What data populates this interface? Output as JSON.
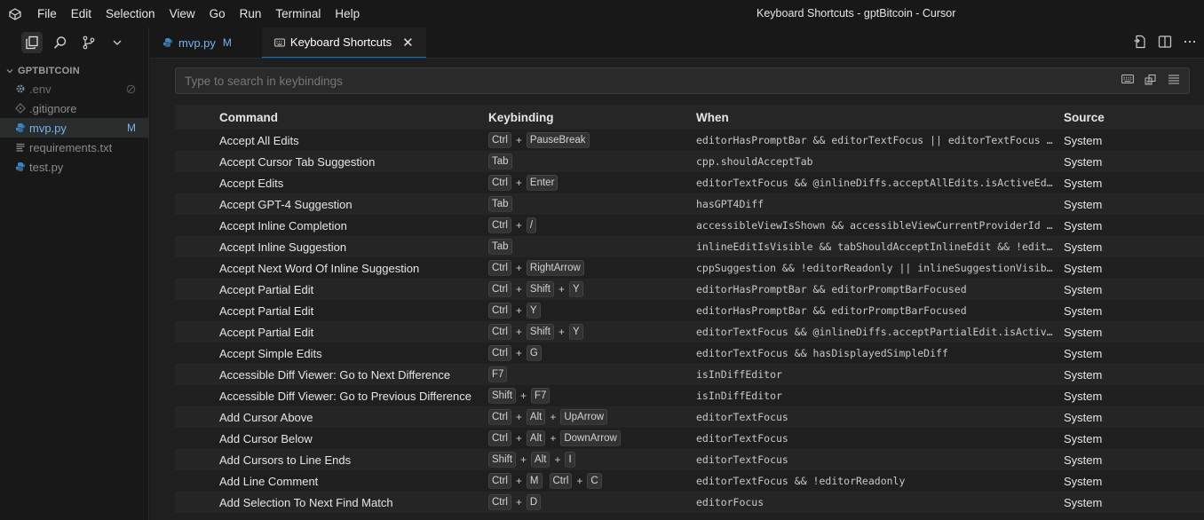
{
  "menu": [
    "File",
    "Edit",
    "Selection",
    "View",
    "Go",
    "Run",
    "Terminal",
    "Help"
  ],
  "window_title": "Keyboard Shortcuts - gptBitcoin - Cursor",
  "explorer": {
    "title": "GPTBITCOIN",
    "files": [
      {
        "name": ".env",
        "icon": "gear-icon",
        "state": "ignored"
      },
      {
        "name": ".gitignore",
        "icon": "git-icon",
        "state": "muted"
      },
      {
        "name": "mvp.py",
        "icon": "python-icon",
        "state": "selected",
        "badge": "M"
      },
      {
        "name": "requirements.txt",
        "icon": "lines-icon",
        "state": "muted"
      },
      {
        "name": "test.py",
        "icon": "python-icon",
        "state": "muted"
      }
    ]
  },
  "tabs": [
    {
      "label": "mvp.py",
      "badge": "M",
      "active": false
    },
    {
      "label": "Keyboard Shortcuts",
      "active": true
    }
  ],
  "search": {
    "placeholder": "Type to search in keybindings"
  },
  "columns": {
    "command": "Command",
    "keybinding": "Keybinding",
    "when": "When",
    "source": "Source"
  },
  "rows": [
    {
      "command": "Accept All Edits",
      "keys": [
        [
          "Ctrl",
          "PauseBreak"
        ]
      ],
      "when": "editorHasPromptBar && editorTextFocus || editorTextFocus && has",
      "source": "System"
    },
    {
      "command": "Accept Cursor Tab Suggestion",
      "keys": [
        [
          "Tab"
        ]
      ],
      "when": "cpp.shouldAcceptTab",
      "source": "System"
    },
    {
      "command": "Accept Edits",
      "keys": [
        [
          "Ctrl",
          "Enter"
        ]
      ],
      "when": "editorTextFocus && @inlineDiffs.acceptAllEdits.isActiveEditor.",
      "source": "System"
    },
    {
      "command": "Accept GPT-4 Suggestion",
      "keys": [
        [
          "Tab"
        ]
      ],
      "when": "hasGPT4Diff",
      "source": "System"
    },
    {
      "command": "Accept Inline Completion",
      "keys": [
        [
          "Ctrl",
          "/"
        ]
      ],
      "when": "accessibleViewIsShown && accessibleViewCurrentProviderId == '",
      "source": "System"
    },
    {
      "command": "Accept Inline Suggestion",
      "keys": [
        [
          "Tab"
        ]
      ],
      "when": "inlineEditIsVisible && tabShouldAcceptInlineEdit && !editorHo",
      "source": "System"
    },
    {
      "command": "Accept Next Word Of Inline Suggestion",
      "keys": [
        [
          "Ctrl",
          "RightArrow"
        ]
      ],
      "when": "cppSuggestion && !editorReadonly || inlineSuggestionVisible &&",
      "source": "System"
    },
    {
      "command": "Accept Partial Edit",
      "keys": [
        [
          "Ctrl",
          "Shift",
          "Y"
        ]
      ],
      "when": "editorHasPromptBar && editorPromptBarFocused",
      "source": "System"
    },
    {
      "command": "Accept Partial Edit",
      "keys": [
        [
          "Ctrl",
          "Y"
        ]
      ],
      "when": "editorHasPromptBar && editorPromptBarFocused",
      "source": "System"
    },
    {
      "command": "Accept Partial Edit",
      "keys": [
        [
          "Ctrl",
          "Shift",
          "Y"
        ]
      ],
      "when": "editorTextFocus && @inlineDiffs.acceptPartialEdit.isActiveEdi",
      "source": "System"
    },
    {
      "command": "Accept Simple Edits",
      "keys": [
        [
          "Ctrl",
          "G"
        ]
      ],
      "when": "editorTextFocus && hasDisplayedSimpleDiff",
      "source": "System"
    },
    {
      "command": "Accessible Diff Viewer: Go to Next Difference",
      "keys": [
        [
          "F7"
        ]
      ],
      "when": "isInDiffEditor",
      "source": "System"
    },
    {
      "command": "Accessible Diff Viewer: Go to Previous Difference",
      "keys": [
        [
          "Shift",
          "F7"
        ]
      ],
      "when": "isInDiffEditor",
      "source": "System"
    },
    {
      "command": "Add Cursor Above",
      "keys": [
        [
          "Ctrl",
          "Alt",
          "UpArrow"
        ]
      ],
      "when": "editorTextFocus",
      "source": "System"
    },
    {
      "command": "Add Cursor Below",
      "keys": [
        [
          "Ctrl",
          "Alt",
          "DownArrow"
        ]
      ],
      "when": "editorTextFocus",
      "source": "System"
    },
    {
      "command": "Add Cursors to Line Ends",
      "keys": [
        [
          "Shift",
          "Alt",
          "I"
        ]
      ],
      "when": "editorTextFocus",
      "source": "System"
    },
    {
      "command": "Add Line Comment",
      "keys": [
        [
          "Ctrl",
          "M"
        ],
        [
          "Ctrl",
          "C"
        ]
      ],
      "when": "editorTextFocus && !editorReadonly",
      "source": "System"
    },
    {
      "command": "Add Selection To Next Find Match",
      "keys": [
        [
          "Ctrl",
          "D"
        ]
      ],
      "when": "editorFocus",
      "source": "System"
    }
  ]
}
